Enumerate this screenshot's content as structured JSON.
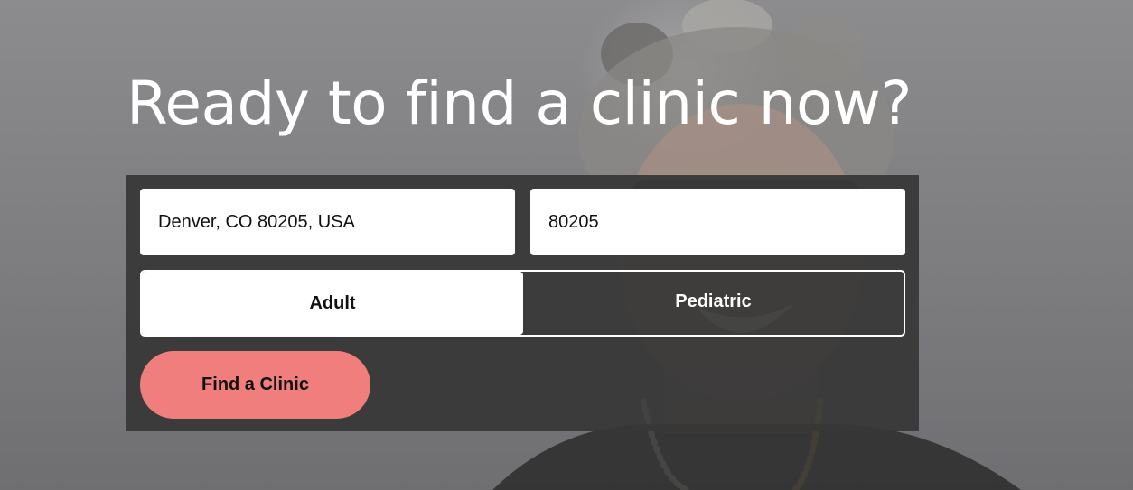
{
  "hero": {
    "headline": "Ready to find a clinic now?"
  },
  "search": {
    "location_value": "Denver, CO 80205, USA",
    "zip_value": "80205",
    "patient_type": {
      "options": [
        "Adult",
        "Pediatric"
      ],
      "selected": "Adult"
    },
    "submit_label": "Find a Clinic"
  },
  "colors": {
    "cta": "#f07e7c",
    "panel": "#373737",
    "headline": "#ffffff"
  }
}
